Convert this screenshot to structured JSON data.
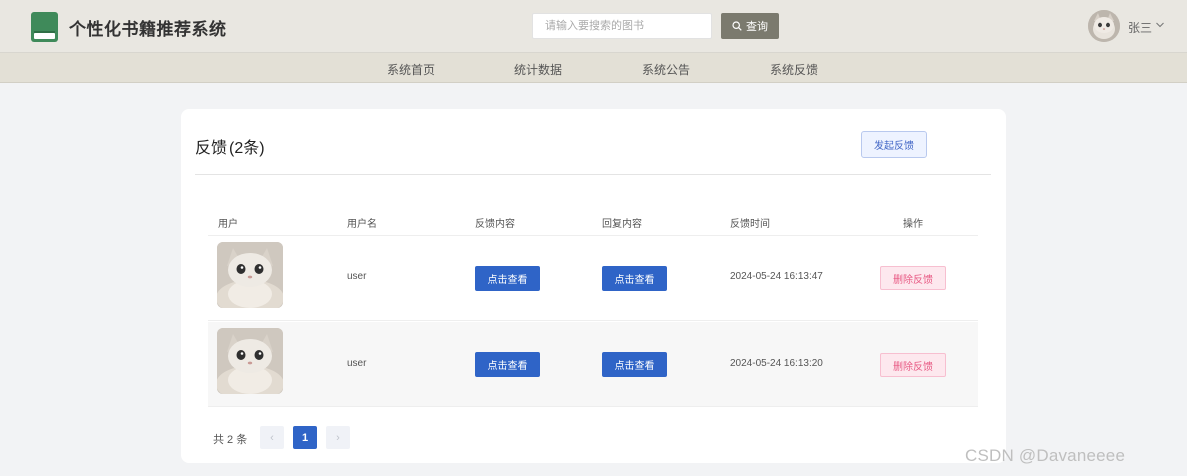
{
  "header": {
    "title": "个性化书籍推荐系统",
    "search_placeholder": "请输入要搜索的图书",
    "search_button": "查询",
    "user_name": "张三"
  },
  "nav": {
    "items": [
      "系统首页",
      "统计数据",
      "系统公告",
      "系统反馈"
    ]
  },
  "feedback": {
    "title": "反馈",
    "count_label": "(2条)",
    "new_button": "发起反馈",
    "columns": [
      "用户",
      "用户名",
      "反馈内容",
      "回复内容",
      "反馈时间",
      "操作"
    ],
    "rows": [
      {
        "username": "user",
        "content_button": "点击查看",
        "reply_button": "点击查看",
        "time": "2024-05-24 16:13:47",
        "delete_button": "删除反馈"
      },
      {
        "username": "user",
        "content_button": "点击查看",
        "reply_button": "点击查看",
        "time": "2024-05-24 16:13:20",
        "delete_button": "删除反馈"
      }
    ]
  },
  "pagination": {
    "total_label": "共 2 条",
    "prev": "‹",
    "current_page": "1",
    "next": "›"
  },
  "watermark": "CSDN @Davaneeee",
  "colors": {
    "header_bg": "#e9e7e1",
    "nav_bg": "#e3e0d6",
    "primary": "#2f64c7",
    "danger": "#e85a84",
    "search_button": "#7b7a6e",
    "logo_green": "#3f8a5a"
  }
}
